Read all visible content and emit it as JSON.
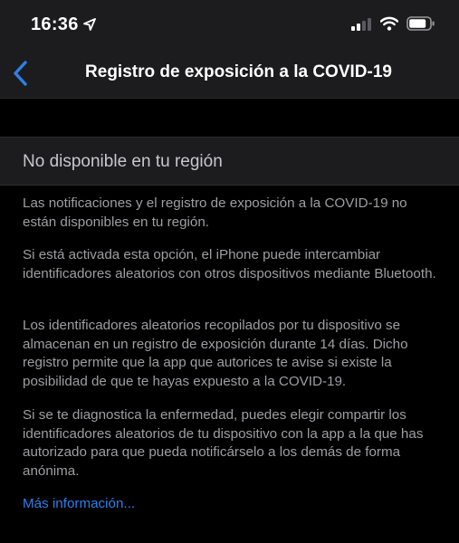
{
  "status_bar": {
    "time": "16:36"
  },
  "nav": {
    "title": "Registro de exposición a la COVID-19"
  },
  "section": {
    "header": "No disponible en tu región"
  },
  "paragraphs": [
    "Las notificaciones y el registro de exposición a la COVID-19 no están disponibles en tu región.",
    "Si está activada esta opción, el iPhone puede intercambiar identificadores aleatorios con otros dispositivos mediante Bluetooth.",
    "Los identificadores aleatorios recopilados por tu dispositivo se almacenan en un registro de exposición durante 14 días. Dicho registro permite que la app que autorices te avise si existe la posibilidad de que te hayas expuesto a la COVID-19.",
    "Si se te diagnostica la enfermedad, puedes elegir compartir los identificadores aleatorios de tu dispositivo con la app a la que has autorizado para que pueda notificárselo a los demás de forma anónima."
  ],
  "link": {
    "more_info": "Más información..."
  },
  "colors": {
    "accent": "#2f7fe8",
    "background": "#000000",
    "bar": "#1c1c1e",
    "secondary_text": "#9e9ea3"
  }
}
